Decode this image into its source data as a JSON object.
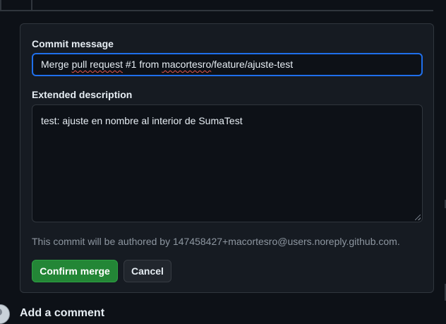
{
  "merge_form": {
    "commit_message_label": "Commit message",
    "commit_message_value_prefix": "Merge ",
    "commit_message_value_spell": "pull request",
    "commit_message_value_mid": " #1 from ",
    "commit_message_value_spell2": "macortesro",
    "commit_message_value_suffix": "/feature/ajuste-test",
    "extended_description_label": "Extended description",
    "extended_description_value": "test: ajuste en nombre al interior de SumaTest",
    "author_note": "This commit will be authored by 147458427+macortesro@users.noreply.github.com.",
    "confirm_label": "Confirm merge",
    "cancel_label": "Cancel"
  },
  "comment_section": {
    "title": "Add a comment"
  },
  "colors": {
    "background": "#0d1117",
    "box_background": "#161b22",
    "border": "#30363d",
    "focus_border": "#1f6feb",
    "confirm_green": "#238636",
    "muted_text": "#8d96a0"
  },
  "icons": {
    "avatar": "avatar-icon",
    "resize": "resize-grip-icon"
  }
}
